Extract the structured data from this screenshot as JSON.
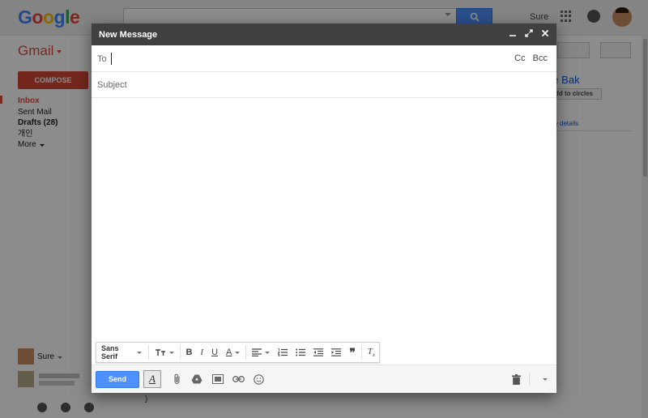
{
  "topbar": {
    "logo_letters": [
      "G",
      "o",
      "o",
      "g",
      "l",
      "e"
    ],
    "logo_colors": [
      "#4285f4",
      "#ea4335",
      "#fbbc05",
      "#4285f4",
      "#34a853",
      "#ea4335"
    ],
    "user_name": "Sure"
  },
  "sidebar": {
    "app_label": "Gmail",
    "compose_label": "COMPOSE",
    "items": [
      {
        "label": "Inbox"
      },
      {
        "label": "Sent Mail"
      },
      {
        "label": "Drafts (28)"
      },
      {
        "label": "개인"
      },
      {
        "label": "More"
      }
    ]
  },
  "right_panel": {
    "contact_name_partial": "re Bak",
    "add_circles_label": "dd to circles",
    "view_details_label": "w details"
  },
  "chat": {
    "user_name": "Sure",
    "code_snippet": "}"
  },
  "compose": {
    "title": "New Message",
    "to_label": "To",
    "to_value": "",
    "cc_label": "Cc",
    "bcc_label": "Bcc",
    "subject_placeholder": "Subject",
    "font_label": "Sans Serif",
    "send_label": "Send"
  },
  "colors": {
    "accent_red": "#dd4b39",
    "send_blue": "#4d90fe",
    "header_dark": "#404040"
  }
}
